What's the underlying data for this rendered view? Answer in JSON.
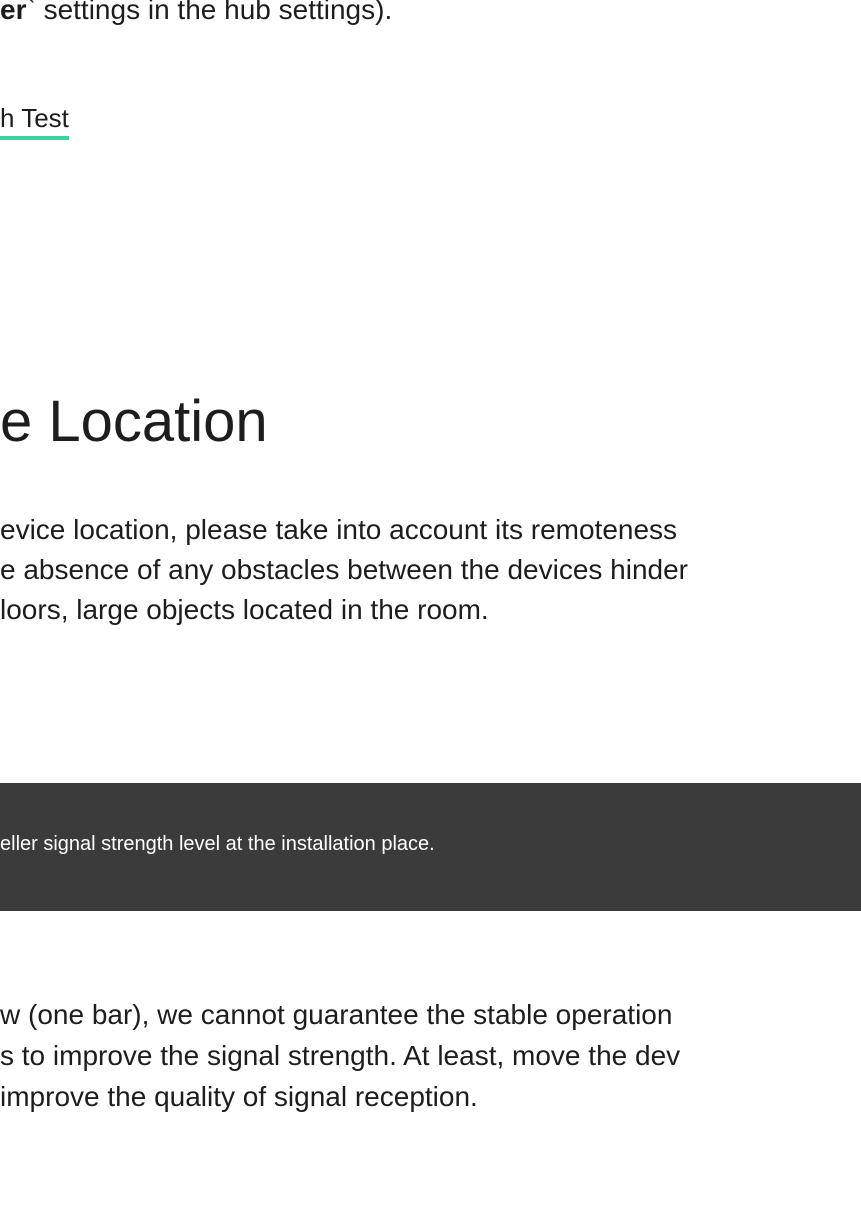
{
  "intro": {
    "bold_fragment": "er",
    "rest": "` settings in the hub settings)."
  },
  "link": {
    "label": "h Test"
  },
  "section": {
    "title": "e Location",
    "paragraph_lines": [
      "evice location, please take into account its remoteness",
      "e absence of any obstacles between the devices hinder",
      "loors, large objects located in the room."
    ]
  },
  "note": {
    "text": "eller signal strength level at the installation place."
  },
  "followup": {
    "paragraph_lines": [
      "w (one bar), we cannot guarantee the stable operation",
      "s to improve the signal strength. At least, move the dev",
      " improve the quality of signal reception."
    ]
  }
}
